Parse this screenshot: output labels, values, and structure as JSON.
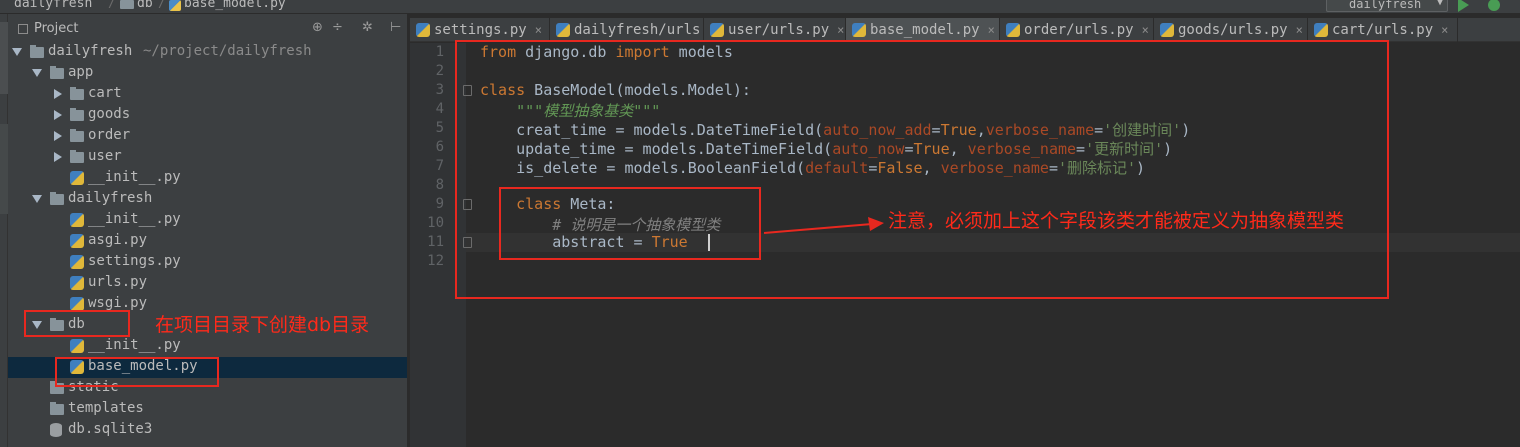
{
  "topbar": {
    "crumbs": [
      "dailyfresh",
      "db",
      "base_model.py"
    ],
    "run_config": "dailyfresh"
  },
  "project_panel": {
    "title": "Project",
    "header_buttons": [
      "⊕",
      "÷",
      "✲",
      "⊢"
    ],
    "tree": [
      {
        "label": "dailyfresh",
        "hint": "~/project/dailyfresh",
        "type": "folder",
        "expanded": true,
        "level": 0
      },
      {
        "label": "app",
        "type": "folder",
        "expanded": true,
        "level": 1
      },
      {
        "label": "cart",
        "type": "folder",
        "expanded": false,
        "level": 2
      },
      {
        "label": "goods",
        "type": "folder",
        "expanded": false,
        "level": 2
      },
      {
        "label": "order",
        "type": "folder",
        "expanded": false,
        "level": 2
      },
      {
        "label": "user",
        "type": "folder",
        "expanded": false,
        "level": 2
      },
      {
        "label": "__init__.py",
        "type": "py",
        "level": 2
      },
      {
        "label": "dailyfresh",
        "type": "folder",
        "expanded": true,
        "level": 1
      },
      {
        "label": "__init__.py",
        "type": "py",
        "level": 2
      },
      {
        "label": "asgi.py",
        "type": "py",
        "level": 2
      },
      {
        "label": "settings.py",
        "type": "py",
        "level": 2
      },
      {
        "label": "urls.py",
        "type": "py",
        "level": 2
      },
      {
        "label": "wsgi.py",
        "type": "py",
        "level": 2
      },
      {
        "label": "db",
        "type": "folder",
        "expanded": true,
        "level": 1
      },
      {
        "label": "__init__.py",
        "type": "py",
        "level": 2
      },
      {
        "label": "base_model.py",
        "type": "py",
        "level": 2,
        "selected": true
      },
      {
        "label": "static",
        "type": "folder",
        "level": 1
      },
      {
        "label": "templates",
        "type": "folder",
        "level": 1
      },
      {
        "label": "db.sqlite3",
        "type": "db",
        "level": 1
      }
    ]
  },
  "tabs": [
    {
      "label": "settings.py",
      "active": false
    },
    {
      "label": "dailyfresh/urls.py",
      "active": false
    },
    {
      "label": "user/urls.py",
      "active": false
    },
    {
      "label": "base_model.py",
      "active": true
    },
    {
      "label": "order/urls.py",
      "active": false
    },
    {
      "label": "goods/urls.py",
      "active": false
    },
    {
      "label": "cart/urls.py",
      "active": false
    }
  ],
  "tab_close": "×",
  "code": {
    "line_numbers": [
      "1",
      "2",
      "3",
      "4",
      "5",
      "6",
      "7",
      "8",
      "9",
      "10",
      "11",
      "12"
    ],
    "lines": [
      [
        {
          "t": "from",
          "c": "kw"
        },
        {
          "t": " django.db "
        },
        {
          "t": "import",
          "c": "kw"
        },
        {
          "t": " models"
        }
      ],
      [],
      [
        {
          "t": "class",
          "c": "kw"
        },
        {
          "t": " BaseModel(models.Model):"
        }
      ],
      [
        {
          "t": "    "
        },
        {
          "t": "\"\"\"模型抽象基类\"\"\"",
          "c": "doc"
        }
      ],
      [
        {
          "t": "    creat_time = models.DateTimeField("
        },
        {
          "t": "auto_now_add",
          "c": "param"
        },
        {
          "t": "="
        },
        {
          "t": "True",
          "c": "kw"
        },
        {
          "t": ","
        },
        {
          "t": "verbose_name",
          "c": "param"
        },
        {
          "t": "="
        },
        {
          "t": "'创建时间'",
          "c": "str"
        },
        {
          "t": ")"
        }
      ],
      [
        {
          "t": "    update_time = models.DateTimeField("
        },
        {
          "t": "auto_now",
          "c": "param"
        },
        {
          "t": "="
        },
        {
          "t": "True",
          "c": "kw"
        },
        {
          "t": ", "
        },
        {
          "t": "verbose_name",
          "c": "param"
        },
        {
          "t": "="
        },
        {
          "t": "'更新时间'",
          "c": "str"
        },
        {
          "t": ")"
        }
      ],
      [
        {
          "t": "    is_delete = models.BooleanField("
        },
        {
          "t": "default",
          "c": "param"
        },
        {
          "t": "="
        },
        {
          "t": "False",
          "c": "kw"
        },
        {
          "t": ", "
        },
        {
          "t": "verbose_name",
          "c": "param"
        },
        {
          "t": "="
        },
        {
          "t": "'删除标记'",
          "c": "str"
        },
        {
          "t": ")"
        }
      ],
      [],
      [
        {
          "t": "    "
        },
        {
          "t": "class",
          "c": "kw"
        },
        {
          "t": " Meta:"
        }
      ],
      [
        {
          "t": "        "
        },
        {
          "t": "# 说明是一个抽象模型类",
          "c": "cmt"
        }
      ],
      [
        {
          "t": "        abstract = "
        },
        {
          "t": "True",
          "c": "kw"
        }
      ],
      []
    ]
  },
  "annotations": {
    "meta_note": "注意，必须加上这个字段该类才能被定义为抽象模型类",
    "db_note": "在项目目录下创建db目录"
  },
  "colors": {
    "annotation_red": "#e8281f",
    "keyword": "#cc7832",
    "string": "#6a8759",
    "selection": "#0d293e"
  }
}
